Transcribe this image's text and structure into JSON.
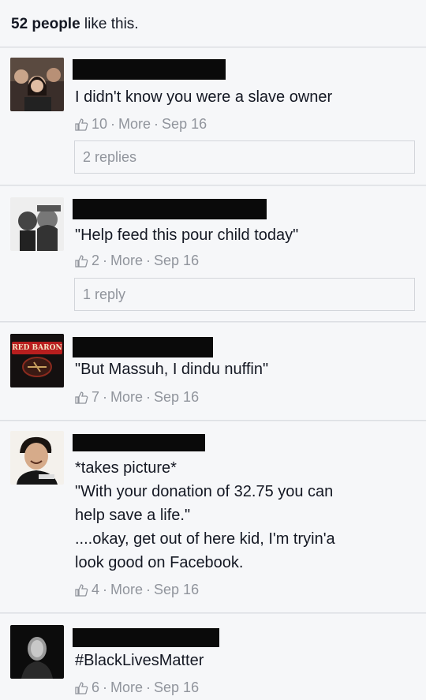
{
  "likes": {
    "count": "52 people",
    "suffix": " like this."
  },
  "comments": [
    {
      "text_lines": [
        "I didn't know you were a slave owner"
      ],
      "likes": "10",
      "more": "More",
      "date": "Sep 16",
      "replies": "2 replies"
    },
    {
      "text_lines": [
        "\"Help feed this pour child today\""
      ],
      "likes": "2",
      "more": "More",
      "date": "Sep 16",
      "replies": "1 reply"
    },
    {
      "avatar_text": "RED BARON",
      "text_lines": [
        "\"But Massuh, I dindu nuffin\""
      ],
      "likes": "7",
      "more": "More",
      "date": "Sep 16"
    },
    {
      "text_lines": [
        "*takes picture*",
        "\"With your donation of 32.75 you can",
        "help save a life.\"",
        "....okay, get out of here kid, I'm tryin'a",
        "look good on Facebook."
      ],
      "likes": "4",
      "more": "More",
      "date": "Sep 16"
    },
    {
      "text_lines": [
        "#BlackLivesMatter"
      ],
      "likes": "6",
      "more": "More",
      "date": "Sep 16"
    }
  ],
  "separator": "·",
  "colors": {
    "background": "#f6f7f9",
    "meta": "#90949c",
    "text": "#141823",
    "redaction": "#0a0a0a"
  }
}
